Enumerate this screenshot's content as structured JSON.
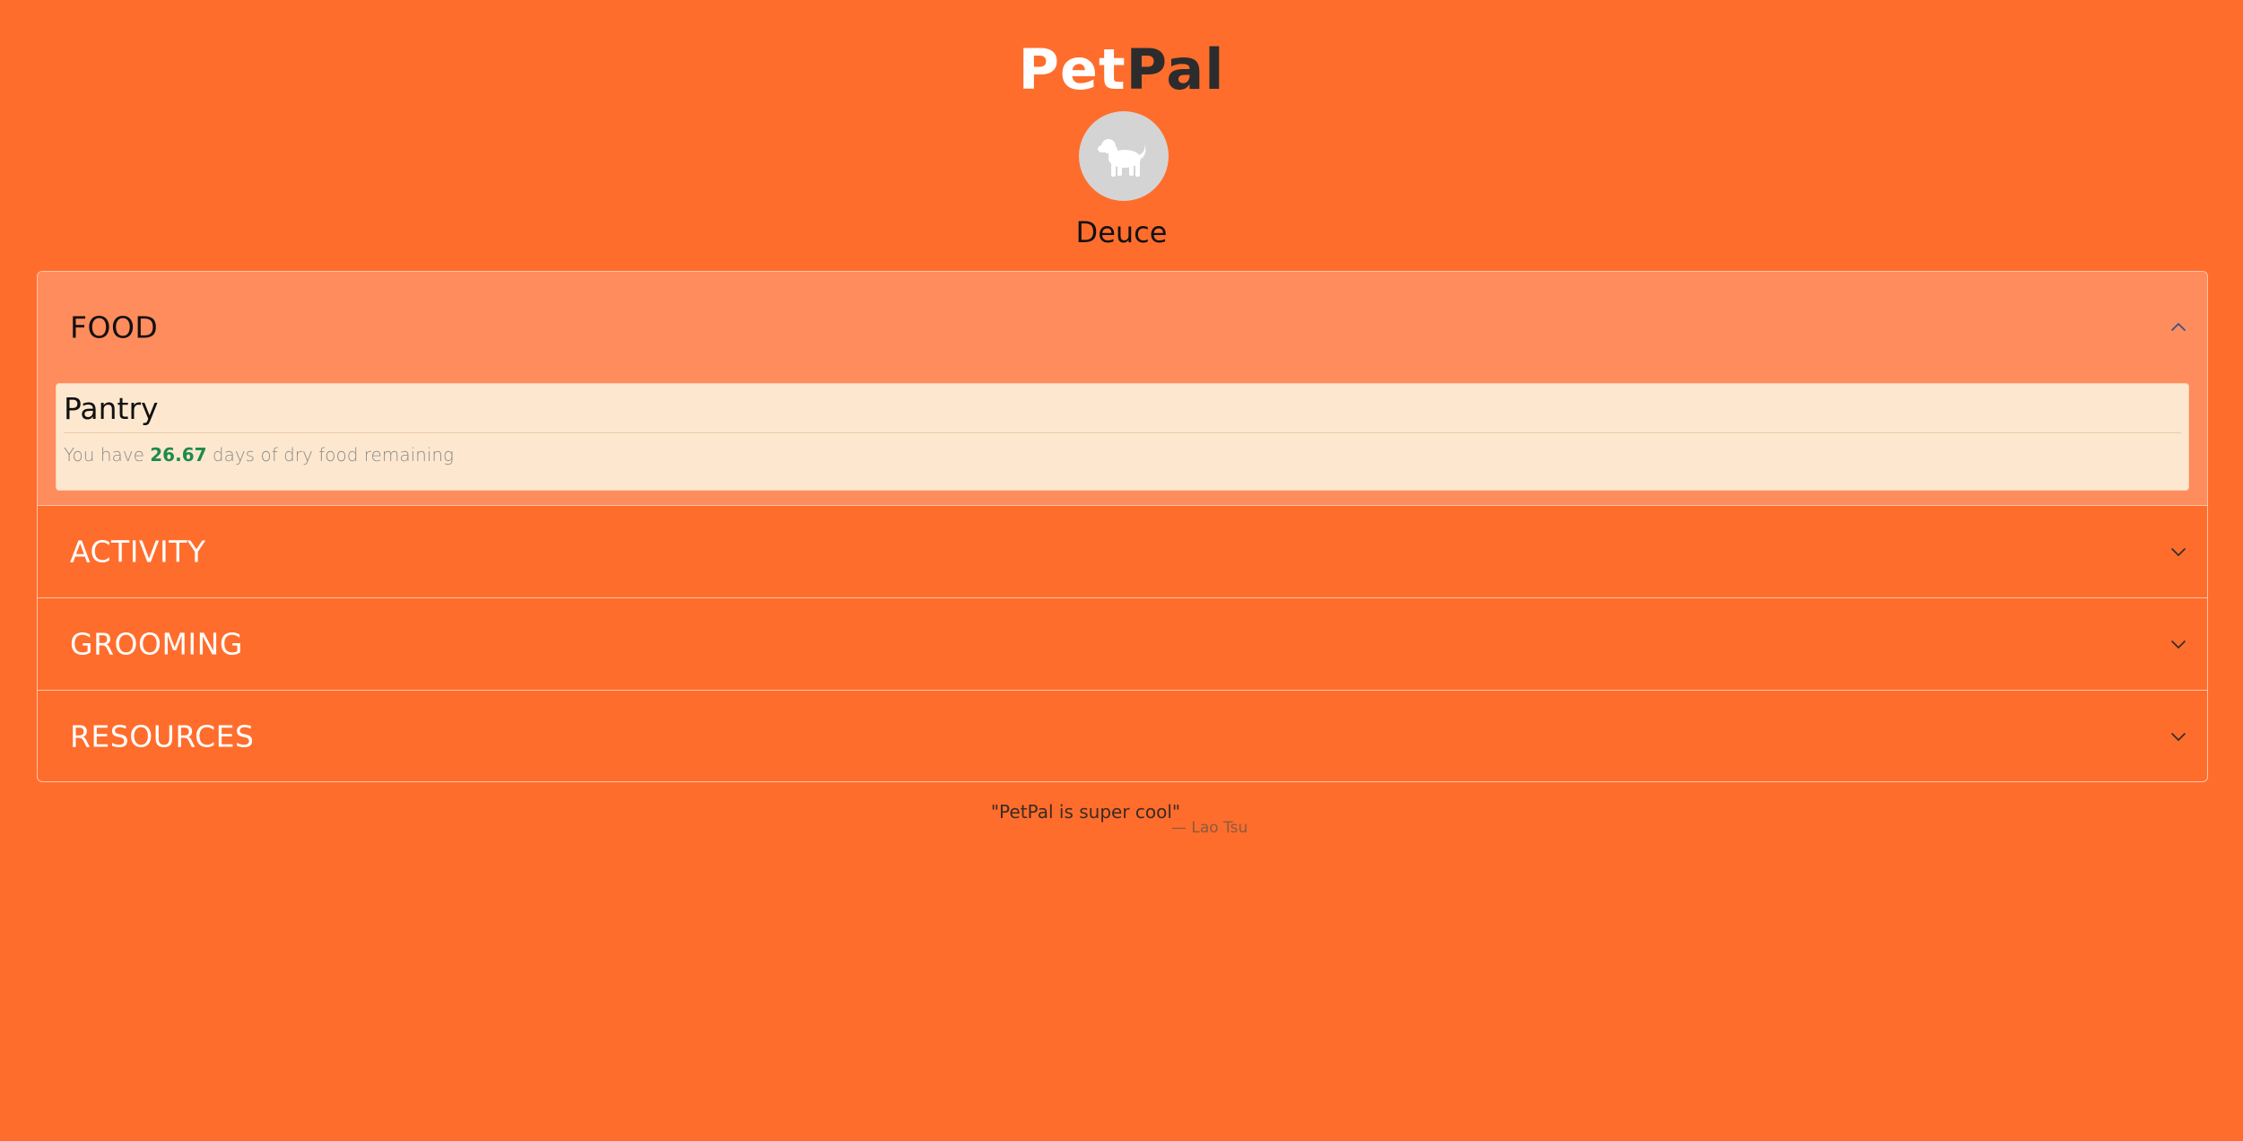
{
  "logo": {
    "part1": "Pet",
    "part2": "Pal"
  },
  "pet": {
    "name": "Deuce",
    "avatar_icon": "dog-icon"
  },
  "sections": [
    {
      "title": "FOOD",
      "expanded": true,
      "chevron_icon": "chevron-up-icon",
      "card": {
        "title": "Pantry",
        "text_before": "You have ",
        "days_value": "26.67",
        "text_after": " days of dry food remaining"
      }
    },
    {
      "title": "ACTIVITY",
      "expanded": false,
      "chevron_icon": "chevron-down-icon"
    },
    {
      "title": "GROOMING",
      "expanded": false,
      "chevron_icon": "chevron-down-icon"
    },
    {
      "title": "RESOURCES",
      "expanded": false,
      "chevron_icon": "chevron-down-icon"
    }
  ],
  "quote": {
    "text": "\"PetPal is super cool\"",
    "author": "— Lao Tsu"
  },
  "colors": {
    "background": "#ff6d2c",
    "expanded_section": "#ff8c5c",
    "card_background": "#fde8cf",
    "highlight_value": "#1f8a4c"
  }
}
